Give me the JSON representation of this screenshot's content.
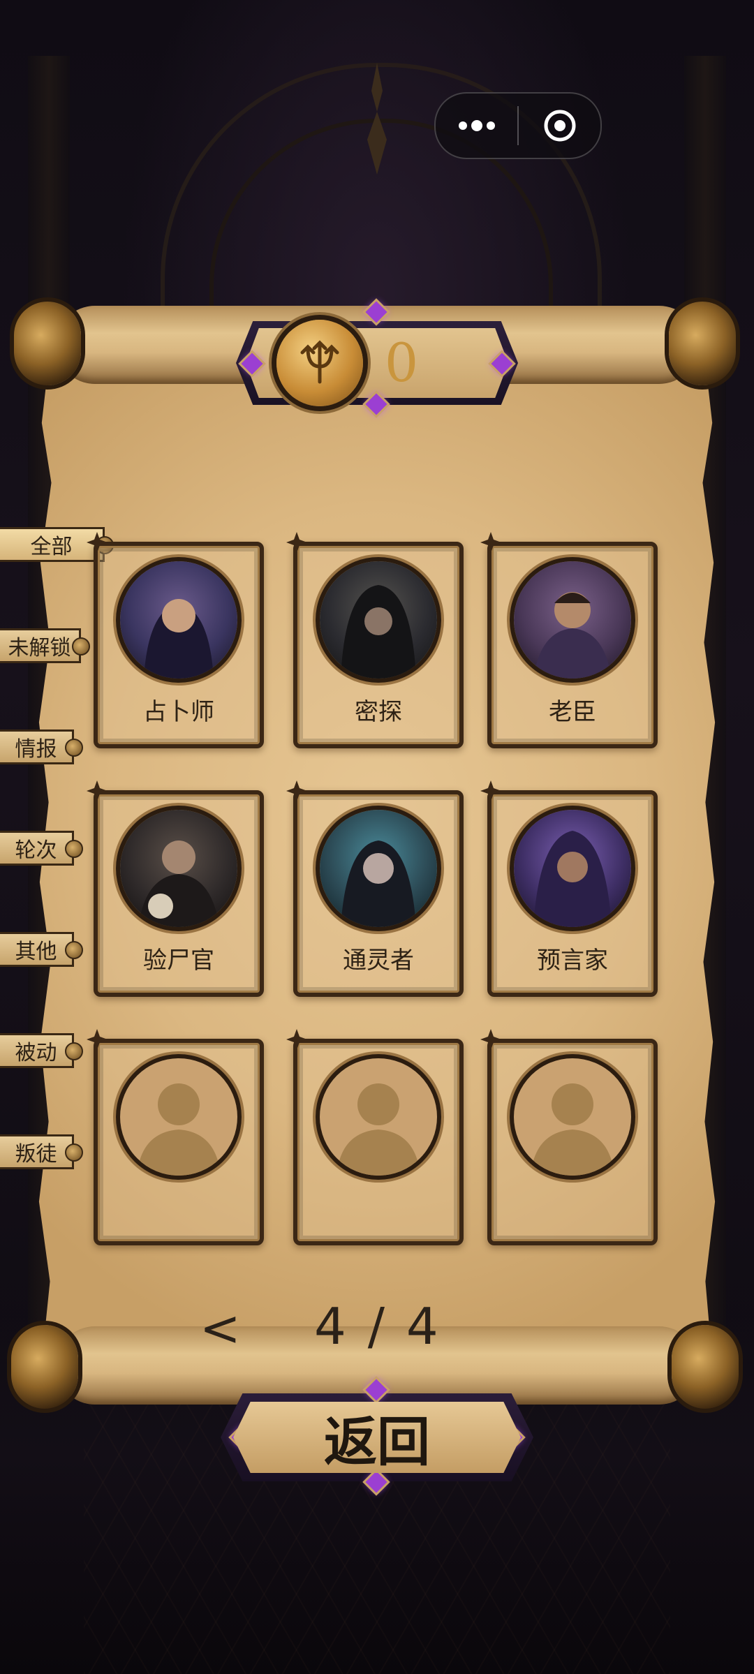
{
  "capsule": {
    "more_icon": "more-dots-icon",
    "close_icon": "target-circle-icon"
  },
  "header": {
    "coin_icon": "trident-coin-icon",
    "coin_count": "0"
  },
  "tabs": [
    {
      "label": "全部",
      "active": true
    },
    {
      "label": "未解锁",
      "active": false
    },
    {
      "label": "情报",
      "active": false
    },
    {
      "label": "轮次",
      "active": false
    },
    {
      "label": "其他",
      "active": false
    },
    {
      "label": "被动",
      "active": false
    },
    {
      "label": "叛徒",
      "active": false
    }
  ],
  "cards": [
    {
      "name": "占卜师",
      "locked": false,
      "hue": "#3a3560"
    },
    {
      "name": "密探",
      "locked": false,
      "hue": "#2b2b30"
    },
    {
      "name": "老臣",
      "locked": false,
      "hue": "#4a3858"
    },
    {
      "name": "验尸官",
      "locked": false,
      "hue": "#2f2a2a"
    },
    {
      "name": "通灵者",
      "locked": false,
      "hue": "#2c4a55"
    },
    {
      "name": "预言家",
      "locked": false,
      "hue": "#3f2f66"
    },
    {
      "name": "",
      "locked": true,
      "hue": "#caa271"
    },
    {
      "name": "",
      "locked": true,
      "hue": "#caa271"
    },
    {
      "name": "",
      "locked": true,
      "hue": "#caa271"
    }
  ],
  "pager": {
    "prev_label": "<",
    "page_text": "4 / 4"
  },
  "footer": {
    "back_label": "返回"
  },
  "colors": {
    "parchment": "#dbb781",
    "gold": "#c9953d",
    "gem": "#9b3fd2",
    "ink": "#2e2215"
  }
}
